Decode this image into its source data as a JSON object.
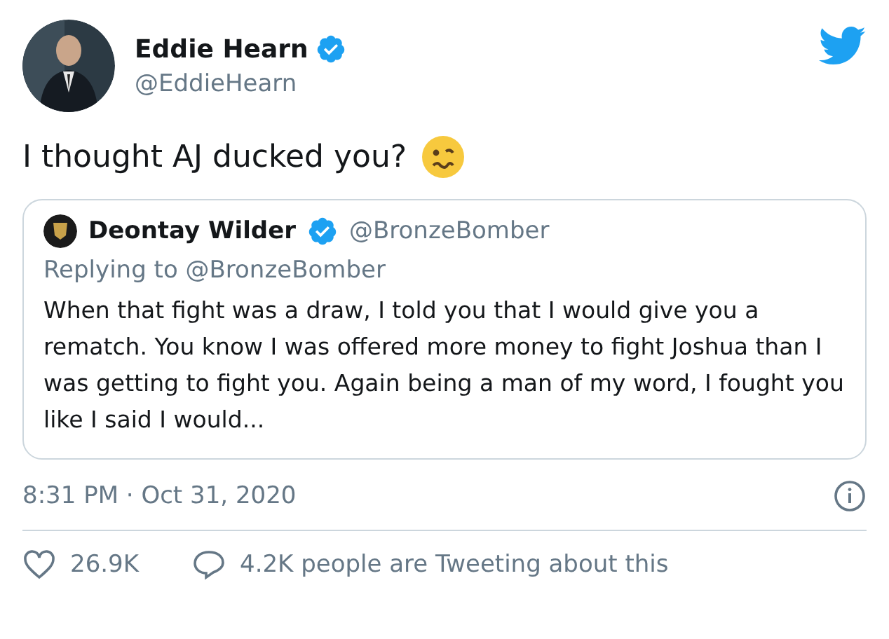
{
  "author": {
    "name": "Eddie Hearn",
    "handle": "@EddieHearn",
    "verified": true
  },
  "text": "I thought AJ ducked you?",
  "quote": {
    "name": "Deontay Wilder",
    "verified": true,
    "handle": "@BronzeBomber",
    "replying_to": "Replying to @BronzeBomber",
    "text": "When that fight was a draw, I told you that I would give you a rematch. You know I was offered more money to fight Joshua than I was getting to fight you. Again being a man of my word, I fought you\nlike I said I would..."
  },
  "timestamp": "8:31 PM · Oct 31, 2020",
  "likes": "26.9K",
  "tweeting": "4.2K people are Tweeting about this"
}
